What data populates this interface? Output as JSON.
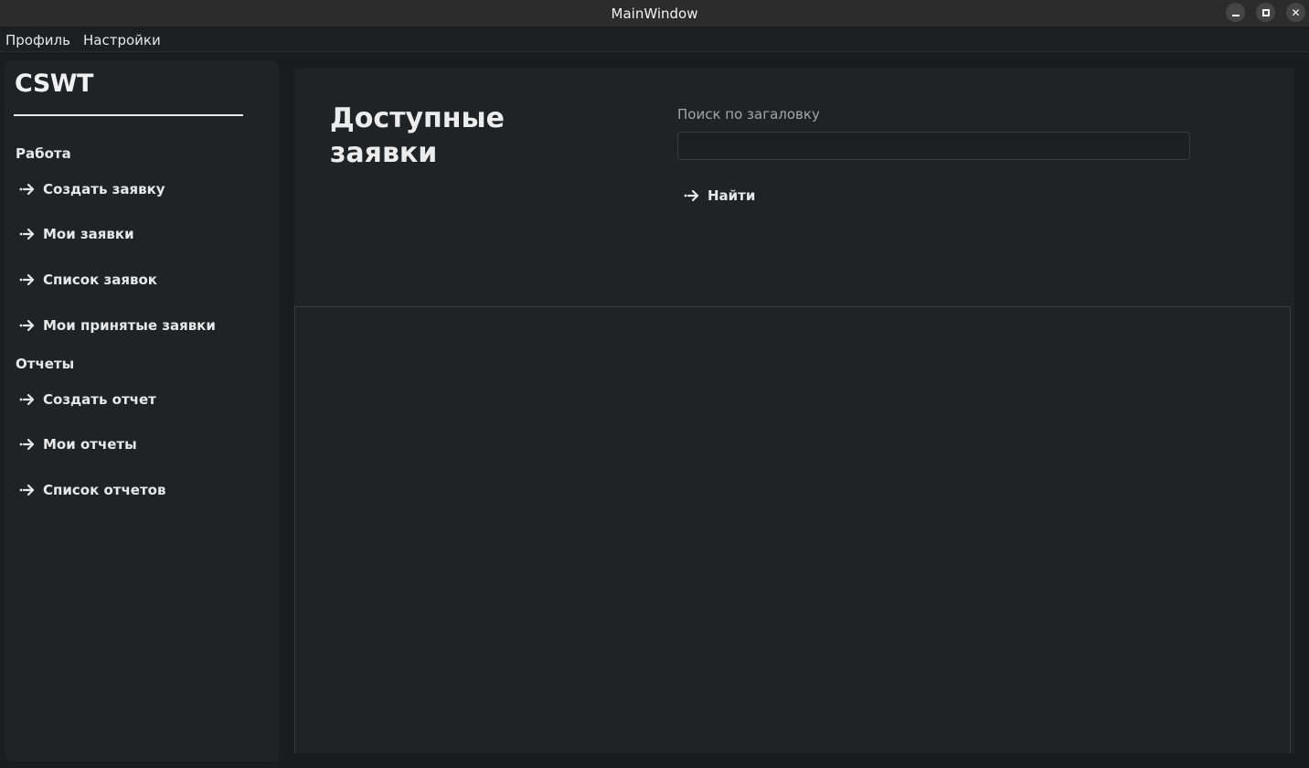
{
  "window": {
    "title": "MainWindow",
    "controls": {
      "minimize_icon": "minimize-icon",
      "maximize_icon": "maximize-icon",
      "close_icon": "close-icon",
      "close_glyph": "✕"
    }
  },
  "menubar": {
    "items": [
      {
        "label": "Профиль"
      },
      {
        "label": "Настройки"
      }
    ]
  },
  "sidebar": {
    "logo": "CSWT",
    "sections": [
      {
        "title": "Работа",
        "items": [
          {
            "label": "Создать заявку",
            "icon": "arrow-right-icon"
          },
          {
            "label": "Мои заявки",
            "icon": "arrow-right-icon"
          },
          {
            "label": "Список заявок",
            "icon": "arrow-right-icon"
          },
          {
            "label": "Мои принятые заявки",
            "icon": "arrow-right-icon"
          }
        ]
      },
      {
        "title": "Отчеты",
        "items": [
          {
            "label": "Создать отчет",
            "icon": "arrow-right-icon"
          },
          {
            "label": "Мои отчеты",
            "icon": "arrow-right-icon"
          },
          {
            "label": "Список отчетов",
            "icon": "arrow-right-icon"
          }
        ]
      }
    ]
  },
  "main": {
    "page_title": "Доступные заявки",
    "search": {
      "label": "Поиск по загаловку",
      "value": "",
      "placeholder": ""
    },
    "find_button": {
      "label": "Найти",
      "icon": "arrow-right-icon"
    }
  },
  "colors": {
    "background": "#1b1c1e",
    "panel": "#212224",
    "titlebar": "#2c2c2c",
    "text": "#e8e8e8",
    "muted_text": "#a6a6a6"
  }
}
